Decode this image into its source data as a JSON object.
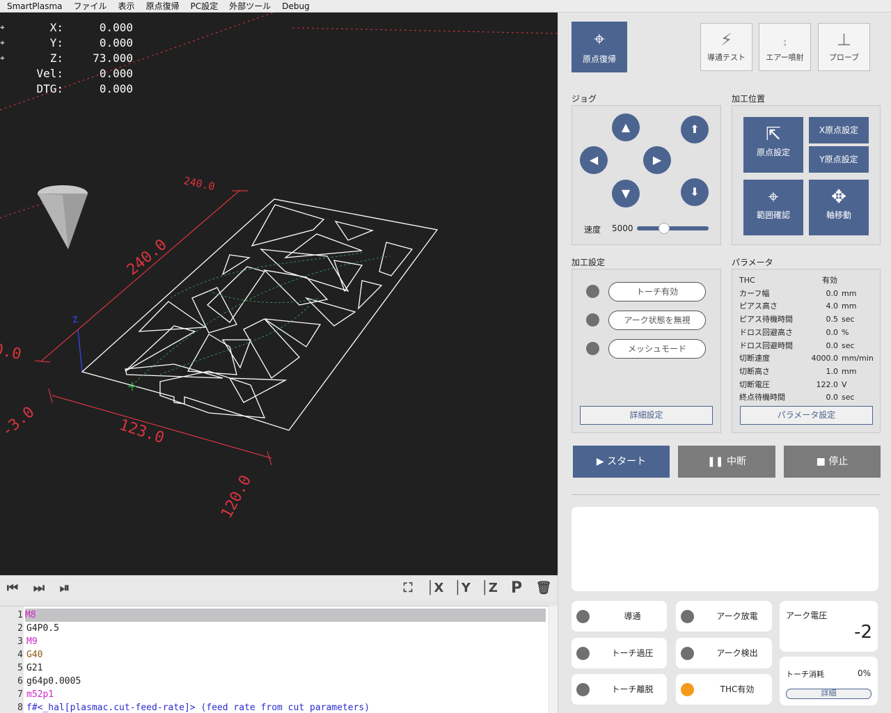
{
  "menu": [
    "SmartPlasma",
    "ファイル",
    "表示",
    "原点復帰",
    "PC設定",
    "外部ツール",
    "Debug"
  ],
  "dro": [
    {
      "label": "X:",
      "value": "0.000"
    },
    {
      "label": "Y:",
      "value": "0.000"
    },
    {
      "label": "Z:",
      "value": "73.000"
    },
    {
      "label": "Vel:",
      "value": "0.000"
    },
    {
      "label": "DTG:",
      "value": "0.000"
    }
  ],
  "preview": {
    "dims": [
      "240.0",
      "240.0",
      "0.0",
      "-3.0",
      "123.0",
      "120.0"
    ],
    "axis_z": "Z"
  },
  "view_toolbar": {
    "p_label": "P"
  },
  "gcode": [
    {
      "n": "1",
      "text": "M8"
    },
    {
      "n": "2",
      "text": "G4P0.5"
    },
    {
      "n": "3",
      "text": "M9"
    },
    {
      "n": "4",
      "text": "G40"
    },
    {
      "n": "5",
      "text": "G21"
    },
    {
      "n": "6",
      "text": "g64p0.0005"
    },
    {
      "n": "7",
      "text": "m52p1"
    },
    {
      "n": "8",
      "text": "f#<_hal[plasmac.cut-feed-rate]> (feed rate from cut parameters)"
    }
  ],
  "top_buttons": {
    "home": "原点復帰",
    "continuity_test": "導通テスト",
    "air_blow": "エアー噴射",
    "probe": "プローブ"
  },
  "jog": {
    "title": "ジョグ",
    "speed_label": "速度",
    "speed_value": "5000",
    "speed_fraction": 0.36
  },
  "work_position": {
    "title": "加工位置",
    "set_origin": "原点設定",
    "x_origin": "X原点設定",
    "y_origin": "Y原点設定",
    "range_check": "範囲確認",
    "axis_move": "軸移動"
  },
  "process_settings": {
    "title": "加工設定",
    "torch_enable": "トーチ有効",
    "ignore_arc": "アーク状態を無視",
    "mesh_mode": "メッシュモード",
    "detail_button": "詳細設定"
  },
  "parameters": {
    "title": "パラメータ",
    "rows": [
      {
        "name": "THC",
        "value": "有効",
        "unit": ""
      },
      {
        "name": "カーフ幅",
        "value": "0.0",
        "unit": "mm"
      },
      {
        "name": "ピアス高さ",
        "value": "4.0",
        "unit": "mm"
      },
      {
        "name": "ピアス待機時間",
        "value": "0.5",
        "unit": "sec"
      },
      {
        "name": "ドロス回避高さ",
        "value": "0.0",
        "unit": "%"
      },
      {
        "name": "ドロス回避時間",
        "value": "0.0",
        "unit": "sec"
      },
      {
        "name": "切断速度",
        "value": "4000.0",
        "unit": "mm/min"
      },
      {
        "name": "切断高さ",
        "value": "1.0",
        "unit": "mm"
      },
      {
        "name": "切断電圧",
        "value": "122.0",
        "unit": "V"
      },
      {
        "name": "終点待機時間",
        "value": "0.0",
        "unit": "sec"
      }
    ],
    "setting_button": "パラメータ設定"
  },
  "controls": {
    "start": "スタート",
    "pause": "中断",
    "stop": "停止"
  },
  "status": [
    {
      "label": "導通",
      "color": "#707070"
    },
    {
      "label": "アーク放電",
      "color": "#707070"
    },
    {
      "label": "トーチ過圧",
      "color": "#707070"
    },
    {
      "label": "アーク検出",
      "color": "#707070"
    },
    {
      "label": "トーチ離脱",
      "color": "#707070"
    },
    {
      "label": "THC有効",
      "color": "#f59a1a"
    }
  ],
  "arc_voltage": {
    "label": "アーク電圧",
    "value": "-2"
  },
  "torch_consumption": {
    "label": "トーチ消耗",
    "value": "0%",
    "detail": "詳細"
  },
  "colors": {
    "accent": "#4c6490",
    "gray_button": "#7b7b7b",
    "viewport_bg": "#202020",
    "dim_red": "#d9343f"
  }
}
